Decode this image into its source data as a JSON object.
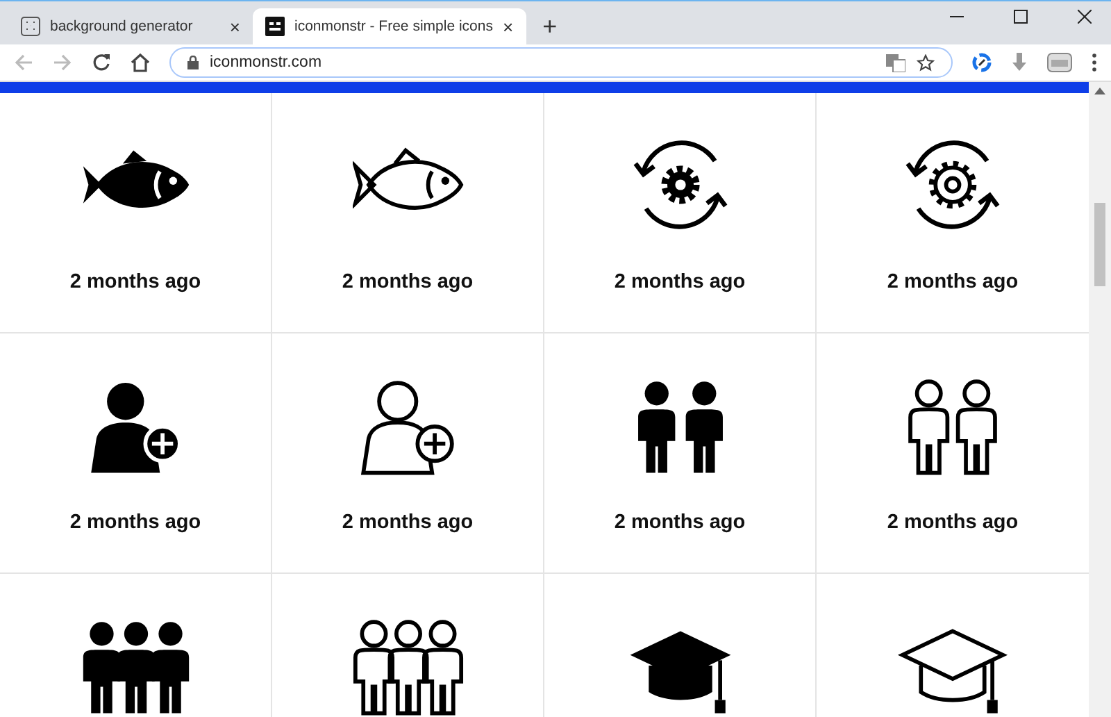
{
  "tabs": [
    {
      "title": "background generator",
      "selected": false,
      "close": "×"
    },
    {
      "title": "iconmonstr - Free simple icons",
      "selected": true,
      "close": "×"
    }
  ],
  "new_tab": "+",
  "address_bar": {
    "url": "iconmonstr.com"
  },
  "icons": [
    {
      "kind": "fish",
      "time": "2 months ago"
    },
    {
      "kind": "fish-outline",
      "time": "2 months ago"
    },
    {
      "kind": "sync-gear",
      "time": "2 months ago"
    },
    {
      "kind": "sync-gear-outline",
      "time": "2 months ago"
    },
    {
      "kind": "user-add",
      "time": "2 months ago"
    },
    {
      "kind": "user-add-outline",
      "time": "2 months ago"
    },
    {
      "kind": "pair",
      "time": "2 months ago"
    },
    {
      "kind": "pair-outline",
      "time": "2 months ago"
    },
    {
      "kind": "group"
    },
    {
      "kind": "group-outline"
    },
    {
      "kind": "mortarboard"
    },
    {
      "kind": "mortarboard-outline"
    }
  ]
}
